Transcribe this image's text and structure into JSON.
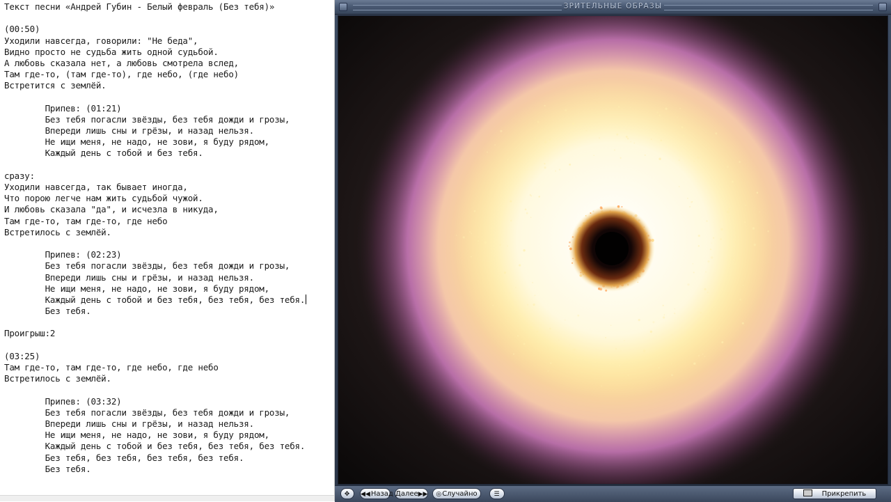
{
  "editor": {
    "lines": [
      "Текст песни «Андрей Губин - Белый февраль (Без тебя)»",
      "",
      "(00:50)",
      "Уходили навсегда, говорили: \"Не беда\",",
      "Видно просто не судьба жить одной судьбой.",
      "А любовь сказала нет, а любовь смотрела вслед,",
      "Там где-то, (там где-то), где небо, (где небо)",
      "Встретится с землёй.",
      "",
      "        Припев: (01:21)",
      "        Без тебя погасли звёзды, без тебя дожди и грозы,",
      "        Впереди лишь сны и грёзы, и назад нельзя.",
      "        Не ищи меня, не надо, не зови, я буду рядом,",
      "        Каждый день с тобой и без тебя.",
      "",
      "сразу:",
      "Уходили навсегда, так бывает иногда,",
      "Что порою легче нам жить судьбой чужой.",
      "И любовь сказала \"да\", и исчезла в никуда,",
      "Там где-то, там где-то, где небо",
      "Встретилось с землёй.",
      "",
      "        Припев: (02:23)",
      "        Без тебя погасли звёзды, без тебя дожди и грозы,",
      "        Впереди лишь сны и грёзы, и назад нельзя.",
      "        Не ищи меня, не надо, не зови, я буду рядом,",
      "        Каждый день с тобой и без тебя, без тебя, без тебя.",
      "        Без тебя.",
      "",
      "Проигрыш:2",
      "",
      "(03:25)",
      "Там где-то, там где-то, где небо, где небо",
      "Встретилось с землёй.",
      "",
      "        Припев: (03:32)",
      "        Без тебя погасли звёзды, без тебя дожди и грозы,",
      "        Впереди лишь сны и грёзы, и назад нельзя.",
      "        Не ищи меня, не надо, не зови, я буду рядом,",
      "        Каждый день с тобой и без тебя, без тебя, без тебя.",
      "        Без тебя, без тебя, без тебя, без тебя.",
      "        Без тебя."
    ],
    "caret_line_index": 26
  },
  "viz": {
    "title": "ЗРИТЕЛЬНЫЕ ОБРАЗЫ",
    "controls": {
      "move_icon": "move-arrows-icon",
      "back_label": "Назад",
      "next_label": "Далее",
      "random_label": "Случайно",
      "menu_icon": "list-menu-icon",
      "pin_label": "Прикрепить"
    }
  },
  "colors": {
    "titlebar": "#4a5a73",
    "core": "#fffbe8",
    "glow_yellow": "#ffe46a",
    "glow_pink": "#e98ad6",
    "background": "#0c0a0a"
  }
}
